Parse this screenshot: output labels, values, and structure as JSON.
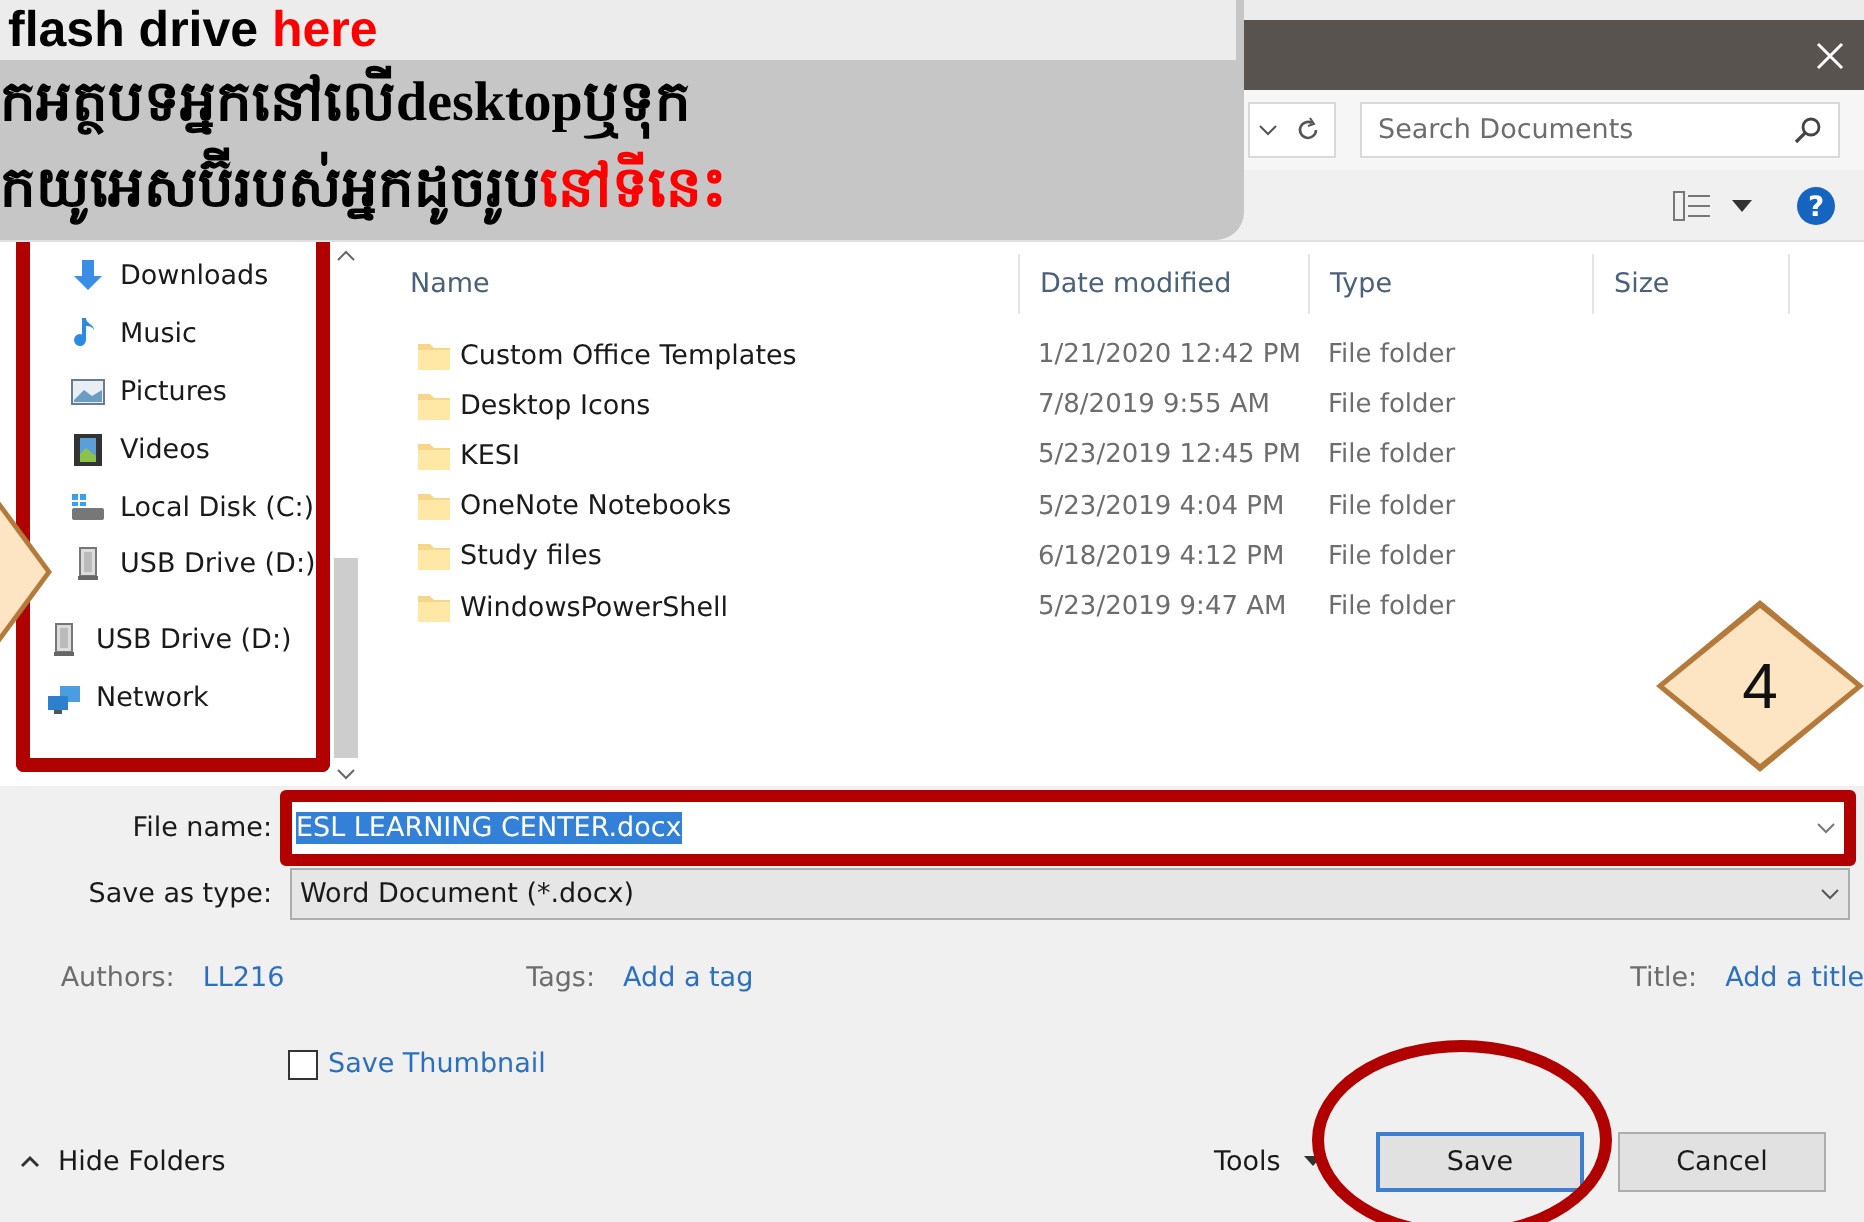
{
  "annotation": {
    "lines": [
      [
        {
          "text": "flash drive ",
          "emphasis": false
        },
        {
          "text": "here",
          "emphasis": true
        }
      ],
      [
        {
          "text": "កអត្ថបទអ្នកនៅលើdesktopឬទុក",
          "emphasis": false
        }
      ],
      [
        {
          "text": "កយូអេសប៊ីរបស់អ្នកដូចរូប",
          "emphasis": false
        },
        {
          "text": "នៅទីនេះ",
          "emphasis": true
        }
      ]
    ]
  },
  "step_marker": {
    "number": "4"
  },
  "search": {
    "placeholder": "Search Documents"
  },
  "nav_sections": [
    {
      "nested": true,
      "items": [
        {
          "label": "Downloads",
          "kind": "download"
        },
        {
          "label": "Music",
          "kind": "music"
        },
        {
          "label": "Pictures",
          "kind": "pictures"
        },
        {
          "label": "Videos",
          "kind": "videos"
        },
        {
          "label": "Local Disk (C:)",
          "kind": "disk"
        },
        {
          "label": "USB Drive (D:)",
          "kind": "usb"
        }
      ]
    },
    {
      "nested": false,
      "items": [
        {
          "label": "USB Drive (D:)",
          "kind": "usb"
        },
        {
          "label": "Network",
          "kind": "network"
        }
      ]
    }
  ],
  "help": "?",
  "file_list": {
    "columns": [
      "Name",
      "Date modified",
      "Type",
      "Size"
    ],
    "rows": [
      {
        "name": "Custom Office Templates",
        "date": "1/21/2020 12:42 PM",
        "type": "File folder"
      },
      {
        "name": "Desktop Icons",
        "date": "7/8/2019 9:55 AM",
        "type": "File folder"
      },
      {
        "name": "KESI",
        "date": "5/23/2019 12:45 PM",
        "type": "File folder"
      },
      {
        "name": "OneNote Notebooks",
        "date": "5/23/2019 4:04 PM",
        "type": "File folder"
      },
      {
        "name": "Study files",
        "date": "6/18/2019 4:12 PM",
        "type": "File folder"
      },
      {
        "name": "WindowsPowerShell",
        "date": "5/23/2019 9:47 AM",
        "type": "File folder"
      }
    ]
  },
  "footer": {
    "file_name_label": "File name:",
    "file_name": "ESL LEARNING CENTER.docx",
    "file_name_selected": true,
    "type_label": "Save as type:",
    "type_value": "Word Document (*.docx)",
    "properties": [
      {
        "label": "Authors:",
        "value": "LL216"
      },
      {
        "label": "Tags:",
        "value": "Add a tag"
      },
      {
        "label": "Title:",
        "value": "Add a title"
      }
    ],
    "thumbnail": {
      "label": "Save Thumbnail",
      "checked": false
    },
    "hide_folders": "Hide Folders",
    "tools": "Tools",
    "save": "Save",
    "cancel": "Cancel"
  }
}
